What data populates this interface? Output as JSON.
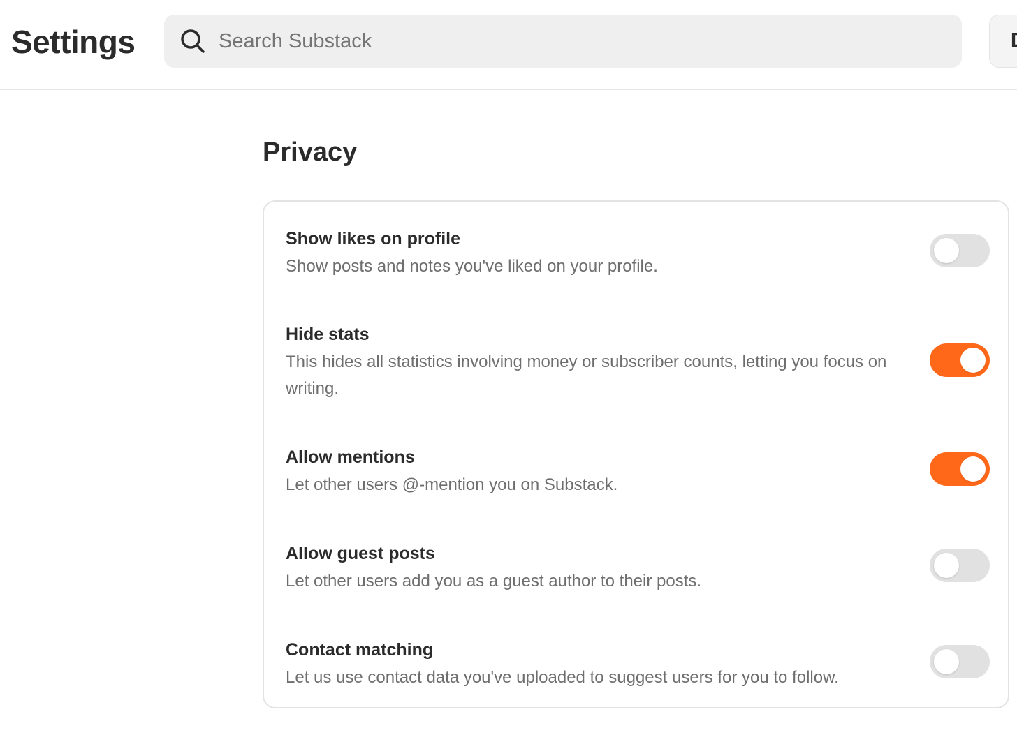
{
  "header": {
    "title": "Settings",
    "search_placeholder": "Search Substack",
    "dashboard_label": "D"
  },
  "privacy": {
    "heading": "Privacy",
    "settings": [
      {
        "label": "Show likes on profile",
        "description": "Show posts and notes you've liked on your profile.",
        "enabled": false
      },
      {
        "label": "Hide stats",
        "description": "This hides all statistics involving money or subscriber counts, letting you focus on writing.",
        "enabled": true
      },
      {
        "label": "Allow mentions",
        "description": "Let other users @-mention you on Substack.",
        "enabled": true
      },
      {
        "label": "Allow guest posts",
        "description": "Let other users add you as a guest author to their posts.",
        "enabled": false
      },
      {
        "label": "Contact matching",
        "description": "Let us use contact data you've uploaded to suggest users for you to follow.",
        "enabled": false
      }
    ]
  },
  "colors": {
    "accent": "#ff6719",
    "toggle_off": "#e1e1e1",
    "text_primary": "#2b2b2b",
    "text_secondary": "#6e6e6e"
  },
  "icons": {
    "search": "search-icon"
  }
}
